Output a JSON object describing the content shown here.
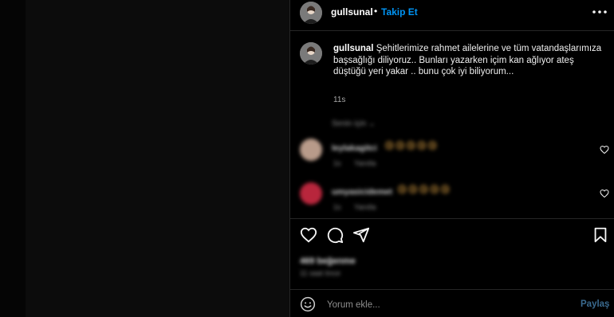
{
  "post": {
    "username": "gullsunal",
    "follow_separator": "•",
    "follow_label": "Takip Et",
    "more_icon": "more-horizontal-icon"
  },
  "caption": {
    "username": "gullsunal",
    "text": "Şehitlerimize rahmet ailelerine ve tüm vatandaşlarımıza başsağlığı diliyoruz.. Bunları yazarken içim kan ağlıyor ateş düştüğü yeri yakar .. bunu çok iyi biliyorum...",
    "time": "11s"
  },
  "translation": {
    "label": "Senin için"
  },
  "comments": [
    {
      "username": "leylakagitci",
      "emojis": "😢😢😢😢😢",
      "time": "1s",
      "reply_label": "Yanıtla",
      "avatar_color": "#b89b8a"
    },
    {
      "username": "umyasicidemet",
      "emojis": "😢😢😢😢😢",
      "time": "1s",
      "reply_label": "Yanıtla",
      "avatar_color": "#b8263c"
    }
  ],
  "actions": {
    "like_icon": "heart-icon",
    "comment_icon": "comment-icon",
    "share_icon": "send-icon",
    "save_icon": "bookmark-icon"
  },
  "likes": "469 beğenme",
  "post_time": "11 saat önce",
  "comment_box": {
    "placeholder": "Yorum ekle...",
    "share_label": "Paylaş",
    "emoji_icon": "emoji-icon"
  },
  "colors": {
    "accent": "#0095f6",
    "background": "#000000",
    "divider": "#262626",
    "share_disabled": "#3a6a8f"
  }
}
